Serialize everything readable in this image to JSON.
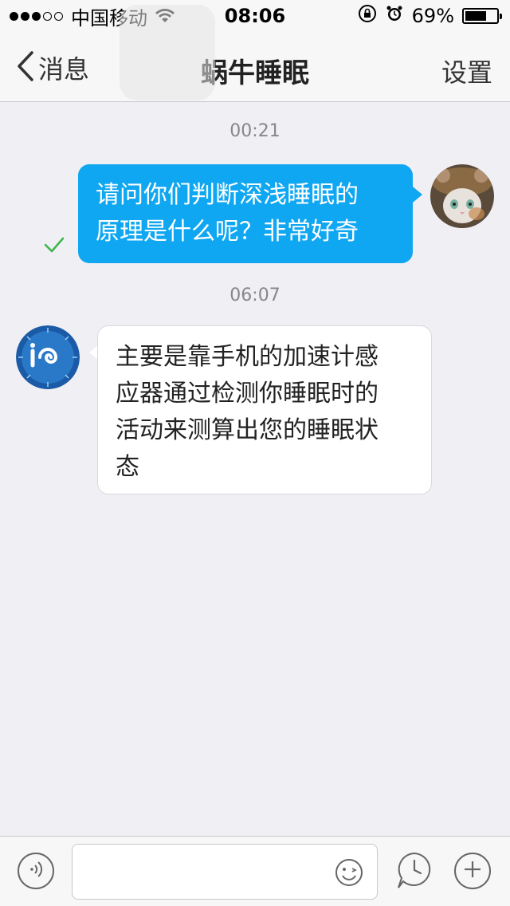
{
  "status_bar": {
    "carrier": "中国移动",
    "time": "08:06",
    "battery_percent_text": "69%",
    "battery_level": 0.69,
    "signal_filled": 3,
    "signal_total": 5
  },
  "nav": {
    "back_label": "消息",
    "title": "蜗牛睡眠",
    "settings_label": "设置"
  },
  "messages": [
    {
      "timestamp": "00:21",
      "direction": "outgoing",
      "text": "请问你们判断深浅睡眠的\n原理是什么呢？非常好奇",
      "status": "sent-check"
    },
    {
      "timestamp": "06:07",
      "direction": "incoming",
      "text": "主要是靠手机的加速计感\n应器通过检测你睡眠时的\n活动来测算出您的睡眠状\n态"
    }
  ],
  "icons": {
    "voice": "voice-icon",
    "emoji": "emoji-icon",
    "clock": "clock-icon",
    "add": "plus-icon"
  },
  "colors": {
    "accent": "#10a7f2",
    "check": "#3db54a",
    "background": "#efeff4"
  }
}
